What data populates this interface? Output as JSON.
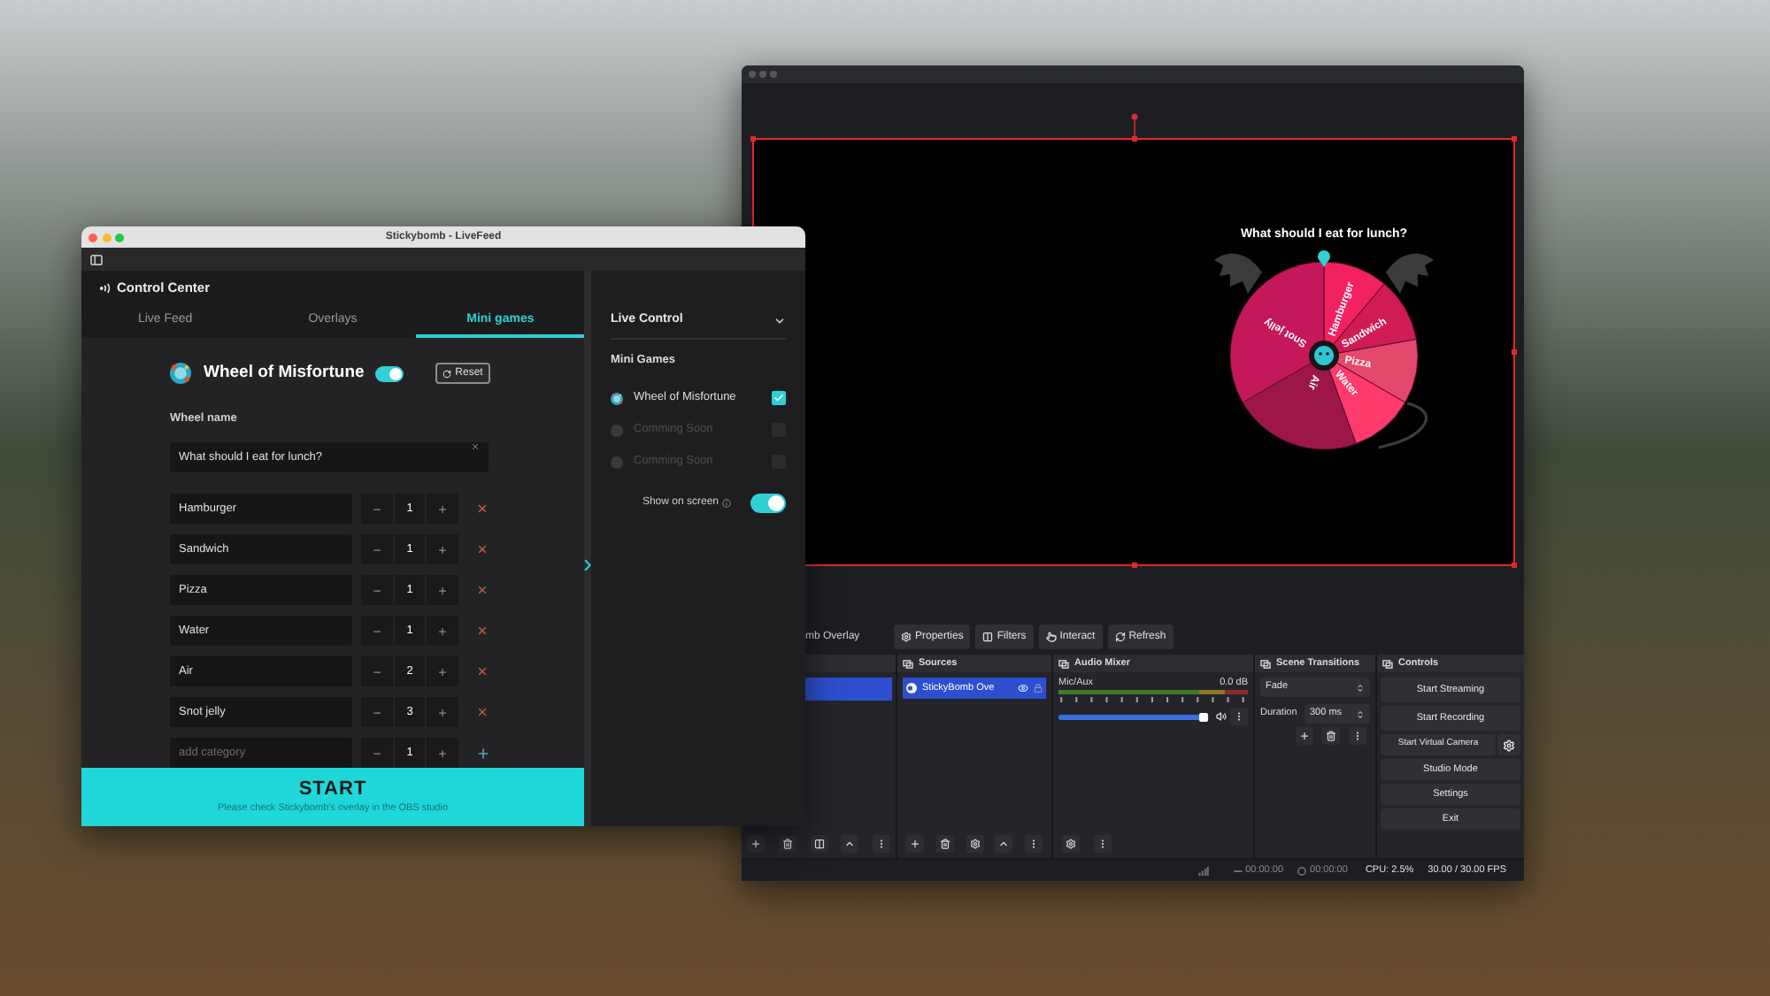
{
  "livefeed_window": {
    "title": "Stickybomb - LiveFeed",
    "header": "Control Center",
    "tabs": [
      {
        "label": "Live Feed",
        "selected": false
      },
      {
        "label": "Overlays",
        "selected": false
      },
      {
        "label": "Mini games",
        "selected": true
      }
    ],
    "game": {
      "title": "Wheel of Misfortune",
      "on": true,
      "reset_button": "Reset"
    },
    "wheel_name": {
      "label": "Wheel name",
      "value": "What should I eat for lunch?"
    },
    "categories": [
      {
        "name": "Hamburger",
        "count": "1"
      },
      {
        "name": "Sandwich",
        "count": "1"
      },
      {
        "name": "Pizza",
        "count": "1"
      },
      {
        "name": "Water",
        "count": "1"
      },
      {
        "name": "Air",
        "count": "2"
      },
      {
        "name": "Snot jelly",
        "count": "3"
      }
    ],
    "new_category": {
      "placeholder": "add category",
      "count": "1"
    },
    "start": {
      "label": "START",
      "hint": "Please check Stickybomb's overlay in the OBS studio"
    },
    "live_control": {
      "title": "Live Control",
      "expanded": true,
      "section": "Mini Games",
      "games": [
        {
          "label": "Wheel of Misfortune",
          "checked": true,
          "disabled": false
        },
        {
          "label": "Comming Soon",
          "checked": false,
          "disabled": true
        },
        {
          "label": "Comming Soon",
          "checked": false,
          "disabled": true
        }
      ],
      "show_on_screen": {
        "label": "Show on screen",
        "on": true
      }
    }
  },
  "obs_window": {
    "preview": {
      "title": "What should I eat for lunch?",
      "segments": [
        {
          "label": "Hamburger",
          "color": "#f2215f"
        },
        {
          "label": "Sandwich",
          "color": "#d11b55"
        },
        {
          "label": "Pizza",
          "color": "#e4486c"
        },
        {
          "label": "Water",
          "color": "#ff3a6d"
        },
        {
          "label": "Air",
          "color": "#9c1747"
        },
        {
          "label": "Snot jelly",
          "color": "#c4185a"
        }
      ]
    },
    "source_toolbar": {
      "source": "mb Overlay",
      "buttons": [
        "Properties",
        "Filters",
        "Interact",
        "Refresh"
      ]
    },
    "scenes": {
      "items": [
        {
          "selected": true
        }
      ]
    },
    "sources": {
      "title": "Sources",
      "items": [
        {
          "name": "StickyBomb Ove",
          "selected": true
        }
      ]
    },
    "audio_mixer": {
      "title": "Audio Mixer",
      "channels": [
        {
          "name": "Mic/Aux",
          "reading": "0.0 dB",
          "level": 0.96
        }
      ]
    },
    "scene_transitions": {
      "title": "Scene Transitions",
      "transition": "Fade",
      "duration_label": "Duration",
      "duration": "300 ms"
    },
    "controls": {
      "title": "Controls",
      "buttons": [
        {
          "label": "Start Streaming",
          "kind": "plain"
        },
        {
          "label": "Start Recording",
          "kind": "plain"
        },
        {
          "label": "Start Virtual Camera",
          "kind": "split"
        },
        {
          "label": "Studio Mode",
          "kind": "plain"
        },
        {
          "label": "Settings",
          "kind": "plain"
        },
        {
          "label": "Exit",
          "kind": "plain"
        }
      ]
    },
    "status_bar": {
      "stream_time": "00:00:00",
      "record_time": "00:00:00",
      "cpu": "CPU: 2.5%",
      "fps": "30.00 / 30.00 FPS"
    }
  }
}
